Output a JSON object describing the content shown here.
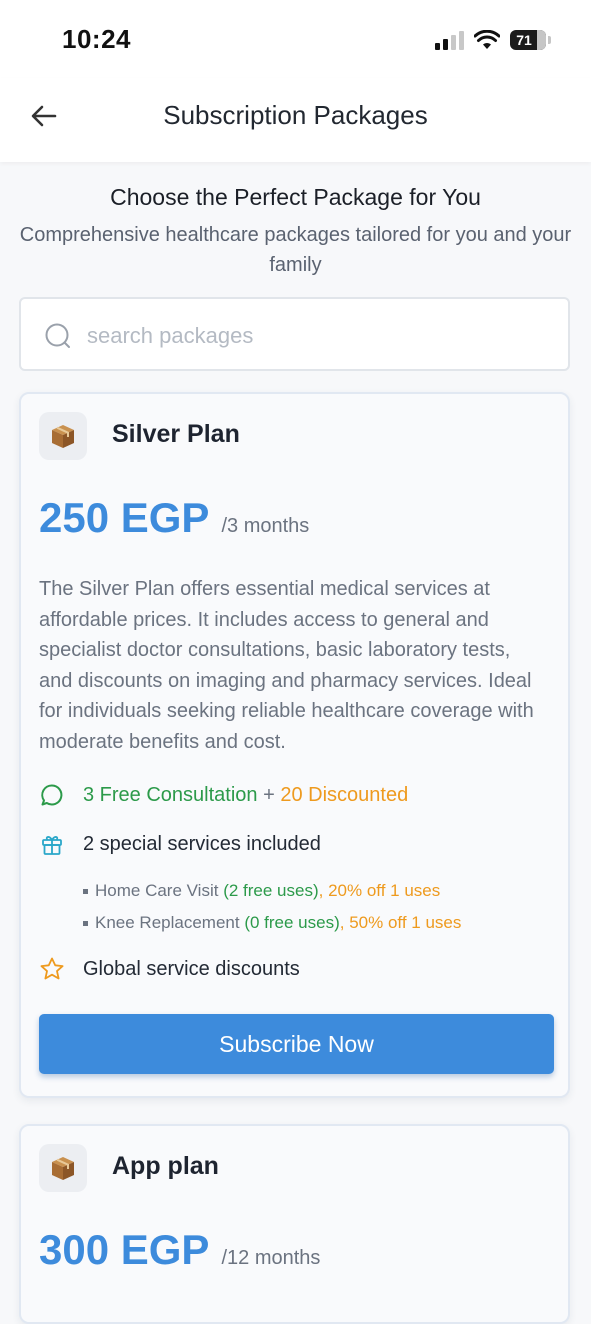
{
  "status_bar": {
    "time": "10:24",
    "battery": "71"
  },
  "header": {
    "title": "Subscription Packages"
  },
  "intro": {
    "title": "Choose the Perfect Package for You",
    "subtitle": "Comprehensive healthcare packages tailored for you and your family"
  },
  "search": {
    "placeholder": "search packages",
    "value": ""
  },
  "packages": [
    {
      "name": "Silver Plan",
      "price": "250 EGP",
      "period": "/3 months",
      "description": "The Silver Plan offers essential medical services at affordable prices. It includes access to general and specialist doctor consultations, basic laboratory tests, and discounts on imaging and pharmacy services. Ideal for individuals seeking reliable healthcare coverage with moderate benefits and cost.",
      "consultations": {
        "free": "3 Free Consultation",
        "plus": " + ",
        "discounted": "20 Discounted"
      },
      "special_services": {
        "label": "2 special services included",
        "items": [
          {
            "name": "Home Care Visit",
            "free": "(2 free uses)",
            "sep": ", ",
            "discount": "20% off 1 uses"
          },
          {
            "name": "Knee Replacement",
            "free": "(0 free uses)",
            "sep": ", ",
            "discount": "50% off 1 uses"
          }
        ]
      },
      "global_discounts": "Global service discounts",
      "button": "Subscribe Now"
    },
    {
      "name": "App plan",
      "price": "300 EGP",
      "period": "/12 months"
    }
  ],
  "colors": {
    "accent": "#3d8bdc",
    "green": "#2c9a4a",
    "orange": "#ee9a1e"
  },
  "icons": [
    "back-arrow-icon",
    "search-icon",
    "package-icon",
    "chat-bubble-icon",
    "gift-icon",
    "star-icon",
    "wifi-icon",
    "signal-icon",
    "battery-icon"
  ]
}
